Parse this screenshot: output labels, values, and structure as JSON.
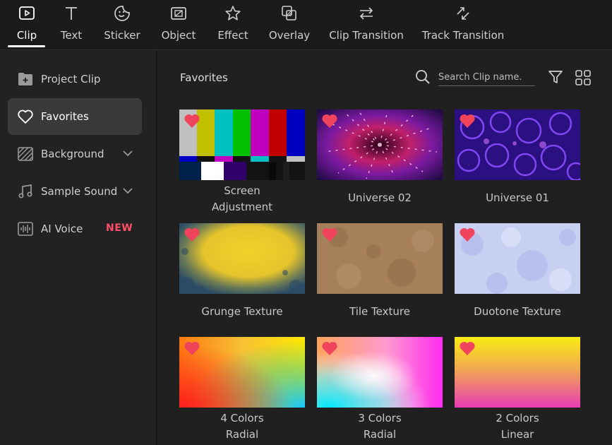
{
  "toolbar": {
    "tabs": [
      {
        "label": "Clip",
        "icon": "clip-icon",
        "active": true
      },
      {
        "label": "Text",
        "icon": "text-icon"
      },
      {
        "label": "Sticker",
        "icon": "sticker-icon"
      },
      {
        "label": "Object",
        "icon": "object-icon"
      },
      {
        "label": "Effect",
        "icon": "effect-icon"
      },
      {
        "label": "Overlay",
        "icon": "overlay-icon"
      },
      {
        "label": "Clip Transition",
        "icon": "clip-transition-icon"
      },
      {
        "label": "Track Transition",
        "icon": "track-transition-icon"
      }
    ]
  },
  "sidebar": {
    "items": [
      {
        "label": "Project Clip",
        "icon": "folder-plus-icon"
      },
      {
        "label": "Favorites",
        "icon": "heart-outline-icon",
        "active": true
      },
      {
        "label": "Background",
        "icon": "background-pattern-icon",
        "expandable": true
      },
      {
        "label": "Sample Sound",
        "icon": "music-note-icon",
        "expandable": true
      },
      {
        "label": "AI Voice",
        "icon": "voice-wave-icon",
        "badge": "NEW"
      }
    ]
  },
  "main": {
    "title": "Favorites",
    "search_placeholder": "Search Clip name.",
    "clips": [
      {
        "line1": "Screen",
        "line2": "Adjustment"
      },
      {
        "line1": "Universe 02",
        "line2": ""
      },
      {
        "line1": "Universe 01",
        "line2": ""
      },
      {
        "line1": "Grunge Texture",
        "line2": ""
      },
      {
        "line1": "Tile Texture",
        "line2": ""
      },
      {
        "line1": "Duotone Texture",
        "line2": ""
      },
      {
        "line1": "4 Colors",
        "line2": "Radial"
      },
      {
        "line1": "3 Colors",
        "line2": "Radial"
      },
      {
        "line1": "2 Colors",
        "line2": "Linear"
      }
    ]
  },
  "colors": {
    "accent_heart": "#f0435c",
    "badge_new": "#ff4f6a",
    "active_bg": "#3a3a3a"
  }
}
